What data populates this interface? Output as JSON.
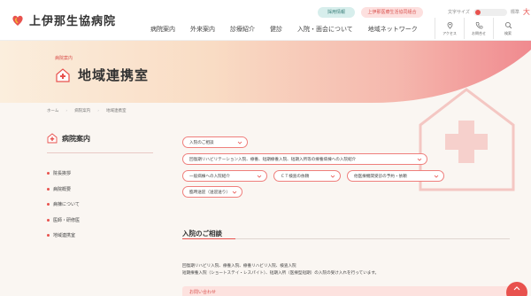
{
  "header": {
    "logo_text": "上伊那生協病院",
    "recruit_label": "採用情報",
    "center_label": "上伊那医療生活協同組合",
    "font_size_label": "文字サイズ",
    "font_size_std": "標準",
    "font_size_large": "大",
    "nav": [
      "病院案内",
      "外来案内",
      "診療紹介",
      "健診",
      "入院・面会について",
      "地域ネットワーク"
    ],
    "icons": [
      {
        "label": "アクセス",
        "icon": "map-pin-icon"
      },
      {
        "label": "お問合せ",
        "icon": "phone-icon"
      },
      {
        "label": "検索",
        "icon": "search-icon"
      }
    ]
  },
  "hero": {
    "crumb": "病院案内",
    "title": "地域連携室"
  },
  "breadcrumb": [
    "ホーム",
    "病院案内",
    "地域連携室"
  ],
  "sidebar": {
    "title": "病院案内",
    "items": [
      "院長挨拶",
      "病院概要",
      "病棟について",
      "医師・研修医",
      "地域連携室"
    ]
  },
  "main": {
    "buttons": [
      "入院のご相談",
      "回復期リハビリテーション入院、療養、短期療養入院、短期入所等の療養病棟への入院紹介",
      "一般病棟への入院紹介",
      "ＣＴ検査の依頼",
      "他医療機関受診の予約・依頼",
      "臨時送迎（送迎送り）"
    ],
    "section_title": "入院のご相談",
    "body_lines": [
      "回復期リハビリ入院、療養入院、療養リハビリ入院、検査入院",
      "短期療養入院（ショートステイ・レスパイト）、短期入所（医療型短期）の入院の受け入れを行っています。"
    ],
    "inquiry_label": "お問い合わせ"
  },
  "colors": {
    "accent": "#e8524e",
    "teal": "#3b7f7a"
  }
}
